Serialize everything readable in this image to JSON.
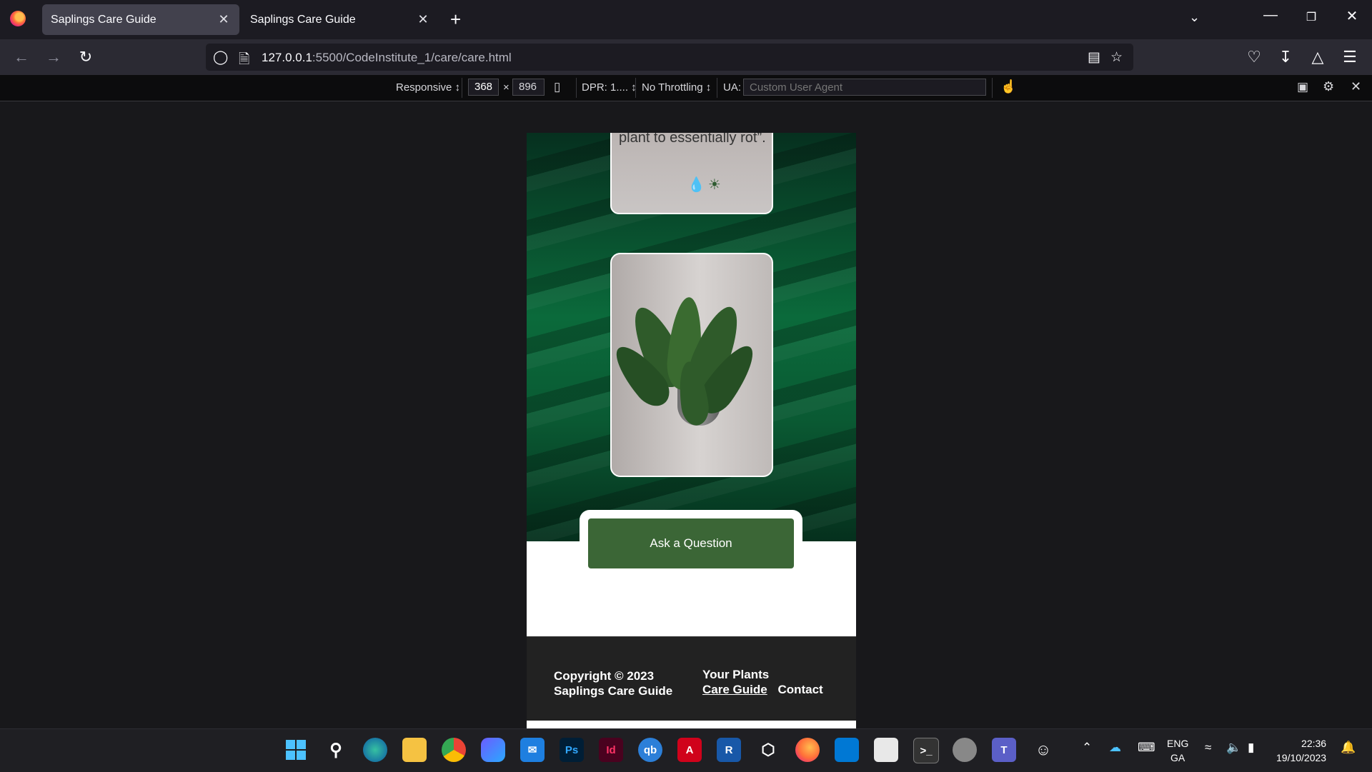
{
  "browser": {
    "tabs": [
      {
        "label": "Saplings Care Guide",
        "active": true
      },
      {
        "label": "Saplings Care Guide",
        "active": false
      }
    ],
    "url_host": "127.0.0.1",
    "url_path": ":5500/CodeInstitute_1/care/care.html"
  },
  "rdm": {
    "mode": "Responsive ↕",
    "width": "368",
    "times": "×",
    "height": "896",
    "dpr": "DPR: 1.... ↕",
    "throttling": "No Throttling ↕",
    "ua_label": "UA:",
    "ua_placeholder": "Custom User Agent"
  },
  "page": {
    "card_text": "plant to essentially rot”.",
    "ask_button": "Ask a Question",
    "copyright_line1": "Copyright © 2023",
    "copyright_line2": "Saplings Care Guide",
    "link_your_plants": "Your Plants",
    "link_care_guide": "Care Guide",
    "link_contact": "Contact"
  },
  "taskbar": {
    "lang1": "ENG",
    "lang2": "GA",
    "time": "22:36",
    "date": "19/10/2023",
    "apps": [
      "start-icon",
      "search-icon",
      "edge-icon",
      "file-explorer-icon",
      "chrome-icon",
      "copilot-icon",
      "mail-icon",
      "photoshop-icon",
      "indesign-icon",
      "quickbooks-icon",
      "autocad-icon",
      "revit-icon",
      "3d-viewer-icon",
      "firefox-icon",
      "vscode-icon",
      "notepad-icon",
      "terminal-icon",
      "spiral-app-icon",
      "teams-icon",
      "emoji-app-icon"
    ],
    "app_labels": {
      "photoshop": "Ps",
      "indesign": "Id",
      "quickbooks": "qb",
      "autocad": "A",
      "revit": "R"
    }
  },
  "colors": {
    "accent_button": "#3b6636",
    "footer_bg": "#222222",
    "tab_active": "#42414d"
  }
}
